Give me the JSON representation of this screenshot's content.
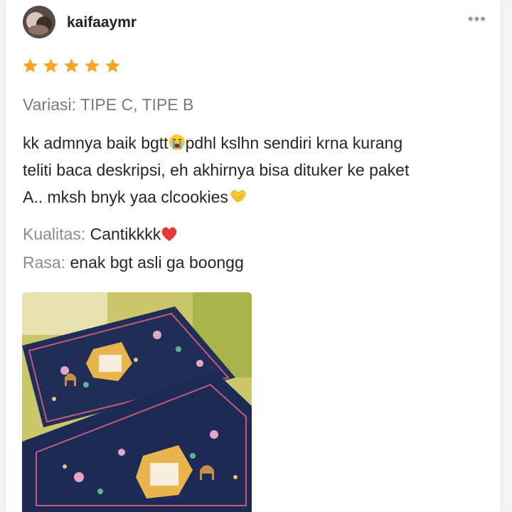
{
  "review": {
    "username": "kaifaaymr",
    "rating": 5,
    "variation": "Variasi: TIPE C, TIPE B",
    "text_line1_a": "kk admnya baik bgtt",
    "text_line1_b": "pdhl kslhn sendiri krna kurang",
    "text_line2": "teliti baca deskripsi, eh akhirnya bisa dituker ke paket",
    "text_line3": "A.. mksh bnyk yaa clcookies",
    "emoji_1": "crying-face-icon",
    "emoji_2": "heart-hands-icon",
    "quality_label": "Kualitas:",
    "quality_value": "Cantikkkk",
    "quality_emoji": "red-heart-icon",
    "taste_label": "Rasa:",
    "taste_value": "enak bgt asli ga boongg"
  },
  "colors": {
    "star": "#f5a623",
    "heart": "#e53935",
    "label_gray": "#8c8c8c"
  }
}
